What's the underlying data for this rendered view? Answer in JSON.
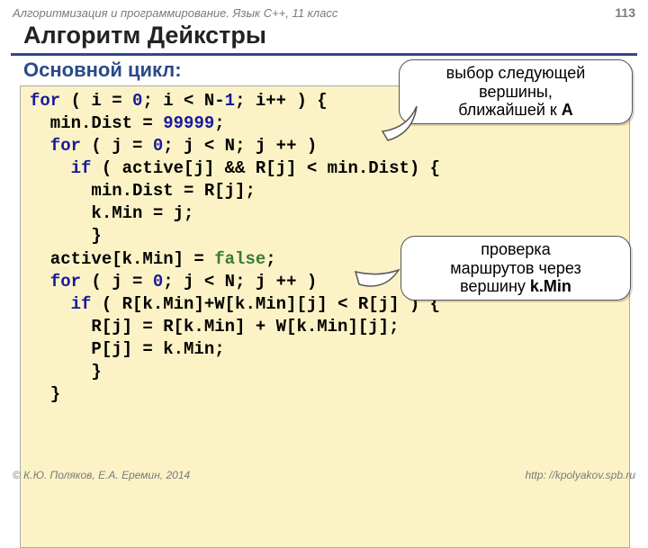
{
  "header": {
    "course": "Алгоритмизация и программирование. Язык С++, 11 класс",
    "page": "113"
  },
  "title": "Алгоритм Дейкстры",
  "subtitle": "Основной цикл:",
  "code": {
    "l1a": "for",
    "l1b": " ( i = ",
    "l1c": "0",
    "l1d": "; i < N-",
    "l1e": "1",
    "l1f": "; i++ ) {",
    "l2a": "  min.Dist = ",
    "l2b": "99999",
    "l2c": ";",
    "l3a": "  for",
    "l3b": " ( j = ",
    "l3c": "0",
    "l3d": "; j < N; j ++ )",
    "l4a": "    if",
    "l4b": " ( active[j] && R[j] < min.Dist) {",
    "l5": "      min.Dist = R[j];",
    "l6": "      k.Min = j;",
    "l7": "      }",
    "l8a": "  active[k.Min] = ",
    "l8b": "false",
    "l8c": ";",
    "l9a": "  for",
    "l9b": " ( j = ",
    "l9c": "0",
    "l9d": "; j < N; j ++ )",
    "l10a": "    if",
    "l10b": " ( R[k.Min]+W[k.Min][j] < R[j] ) {",
    "l11": "      R[j] = R[k.Min] + W[k.Min][j];",
    "l12": "      P[j] = k.Min;",
    "l13": "      }",
    "l14": "  }"
  },
  "callouts": {
    "c1_l1": "выбор следующей",
    "c1_l2": "вершины,",
    "c1_l3a": "ближайшей к ",
    "c1_l3b": "A",
    "c2_l1": "проверка",
    "c2_l2": "маршрутов через",
    "c2_l3a": "вершину ",
    "c2_l3b": "k.Min"
  },
  "footer": {
    "authors": "© К.Ю. Поляков, Е.А. Еремин, 2014",
    "url": "http: //kpolyakov.spb.ru"
  }
}
